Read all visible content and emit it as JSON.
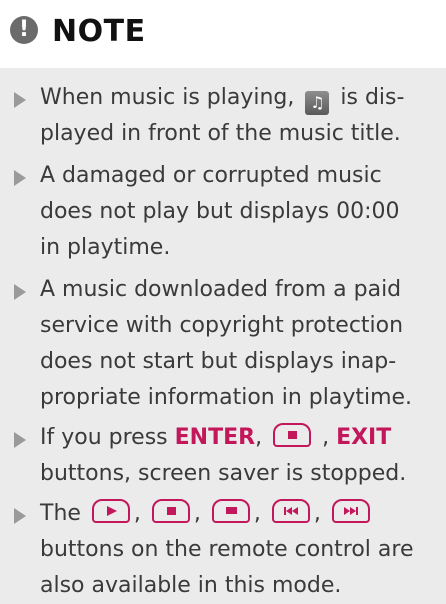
{
  "note": {
    "icon": "exclamation-circle-icon",
    "title": "NOTE"
  },
  "items": [
    {
      "lines": [
        "When music is playing,",
        "is dis-",
        "played in front of the music title."
      ]
    },
    {
      "lines": [
        "A damaged or corrupted music",
        "does not play but displays 00:00",
        "in playtime."
      ]
    },
    {
      "lines": [
        "A music downloaded from a paid",
        "service with copyright protection",
        "does not start but displays inap-",
        "propriate information in playtime."
      ]
    },
    {
      "prefix": "If you press",
      "enter": "ENTER",
      "sep1": ",",
      "sep2": ",",
      "exit": "EXIT",
      "line2": "buttons, screen saver is  stopped."
    },
    {
      "prefix": "The",
      "comma": ",",
      "line2": "buttons on the remote control are",
      "line3": "also available in this mode."
    }
  ],
  "colors": {
    "accent": "#c2185b",
    "panel_bg": "#ebebeb",
    "text": "#3a3a3a",
    "bullet": "#9a9a9a"
  },
  "icons": [
    "music-note-icon",
    "stop-button-icon",
    "play-button-icon",
    "pause-button-icon",
    "rewind-button-icon",
    "skip-forward-button-icon"
  ]
}
